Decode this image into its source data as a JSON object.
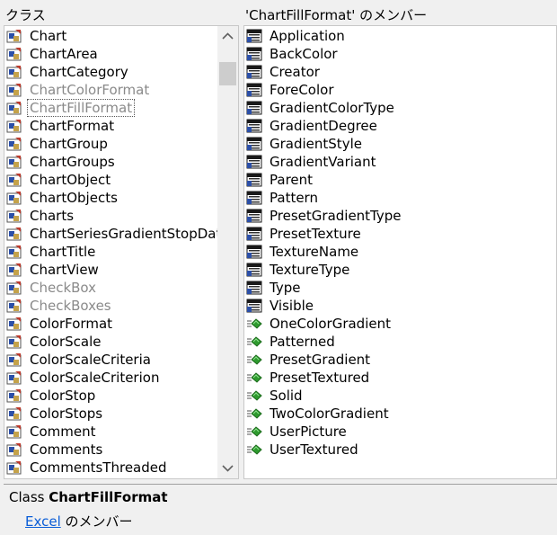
{
  "classes_header": "クラス",
  "members_header": "'ChartFillFormat' のメンバー",
  "classes": [
    {
      "label": "Chart",
      "dim": false,
      "selected": false
    },
    {
      "label": "ChartArea",
      "dim": false,
      "selected": false
    },
    {
      "label": "ChartCategory",
      "dim": false,
      "selected": false
    },
    {
      "label": "ChartColorFormat",
      "dim": true,
      "selected": false
    },
    {
      "label": "ChartFillFormat",
      "dim": true,
      "selected": true
    },
    {
      "label": "ChartFormat",
      "dim": false,
      "selected": false
    },
    {
      "label": "ChartGroup",
      "dim": false,
      "selected": false
    },
    {
      "label": "ChartGroups",
      "dim": false,
      "selected": false
    },
    {
      "label": "ChartObject",
      "dim": false,
      "selected": false
    },
    {
      "label": "ChartObjects",
      "dim": false,
      "selected": false
    },
    {
      "label": "Charts",
      "dim": false,
      "selected": false
    },
    {
      "label": "ChartSeriesGradientStopData",
      "dim": false,
      "selected": false
    },
    {
      "label": "ChartTitle",
      "dim": false,
      "selected": false
    },
    {
      "label": "ChartView",
      "dim": false,
      "selected": false
    },
    {
      "label": "CheckBox",
      "dim": true,
      "selected": false
    },
    {
      "label": "CheckBoxes",
      "dim": true,
      "selected": false
    },
    {
      "label": "ColorFormat",
      "dim": false,
      "selected": false
    },
    {
      "label": "ColorScale",
      "dim": false,
      "selected": false
    },
    {
      "label": "ColorScaleCriteria",
      "dim": false,
      "selected": false
    },
    {
      "label": "ColorScaleCriterion",
      "dim": false,
      "selected": false
    },
    {
      "label": "ColorStop",
      "dim": false,
      "selected": false
    },
    {
      "label": "ColorStops",
      "dim": false,
      "selected": false
    },
    {
      "label": "Comment",
      "dim": false,
      "selected": false
    },
    {
      "label": "Comments",
      "dim": false,
      "selected": false
    },
    {
      "label": "CommentsThreaded",
      "dim": false,
      "selected": false
    }
  ],
  "members": [
    {
      "label": "Application",
      "kind": "property"
    },
    {
      "label": "BackColor",
      "kind": "property"
    },
    {
      "label": "Creator",
      "kind": "property"
    },
    {
      "label": "ForeColor",
      "kind": "property"
    },
    {
      "label": "GradientColorType",
      "kind": "property"
    },
    {
      "label": "GradientDegree",
      "kind": "property"
    },
    {
      "label": "GradientStyle",
      "kind": "property"
    },
    {
      "label": "GradientVariant",
      "kind": "property"
    },
    {
      "label": "Parent",
      "kind": "property"
    },
    {
      "label": "Pattern",
      "kind": "property"
    },
    {
      "label": "PresetGradientType",
      "kind": "property"
    },
    {
      "label": "PresetTexture",
      "kind": "property"
    },
    {
      "label": "TextureName",
      "kind": "property"
    },
    {
      "label": "TextureType",
      "kind": "property"
    },
    {
      "label": "Type",
      "kind": "property"
    },
    {
      "label": "Visible",
      "kind": "property"
    },
    {
      "label": "OneColorGradient",
      "kind": "method"
    },
    {
      "label": "Patterned",
      "kind": "method"
    },
    {
      "label": "PresetGradient",
      "kind": "method"
    },
    {
      "label": "PresetTextured",
      "kind": "method"
    },
    {
      "label": "Solid",
      "kind": "method"
    },
    {
      "label": "TwoColorGradient",
      "kind": "method"
    },
    {
      "label": "UserPicture",
      "kind": "method"
    },
    {
      "label": "UserTextured",
      "kind": "method"
    }
  ],
  "details": {
    "kind": "Class",
    "name": "ChartFillFormat",
    "library_link": "Excel",
    "member_of": "のメンバー"
  },
  "icons": {
    "class": "class-module-icon",
    "property": "property-icon",
    "method": "method-icon",
    "scroll_up": "chevron-up-icon",
    "scroll_down": "chevron-down-icon"
  },
  "colors": {
    "link": "#0b5ed7",
    "dim_text": "#8a8a8a",
    "method_green": "#2e9a2e"
  }
}
